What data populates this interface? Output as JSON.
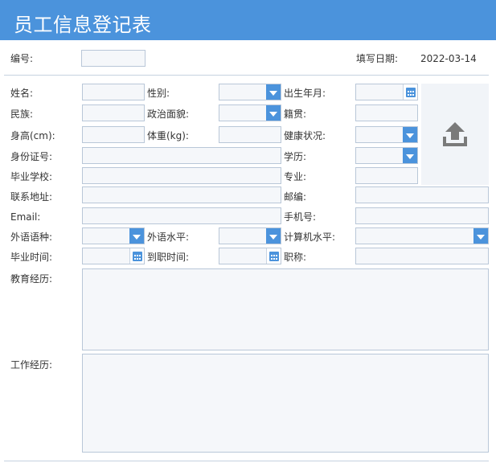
{
  "window": {
    "title": "员工信息登记表"
  },
  "header": {
    "serial_label": "编号:",
    "serial_value": "",
    "fill_date_label": "填写日期:",
    "fill_date_value": "2022-03-14"
  },
  "form": {
    "name_label": "姓名:",
    "gender_label": "性别:",
    "birth_label": "出生年月:",
    "ethnicity_label": "民族:",
    "political_label": "政治面貌:",
    "native_place_label": "籍贯:",
    "height_label": "身高(cm):",
    "weight_label": "体重(kg):",
    "health_label": "健康状况:",
    "id_number_label": "身份证号:",
    "education_label": "学历:",
    "school_label": "毕业学校:",
    "major_label": "专业:",
    "address_label": "联系地址:",
    "postcode_label": "邮编:",
    "email_label": "Email:",
    "mobile_label": "手机号:",
    "language_label": "外语语种:",
    "language_level_label": "外语水平:",
    "computer_level_label": "计算机水平:",
    "graduation_time_label": "毕业时间:",
    "onboard_time_label": "到职时间:",
    "title_label": "职称:",
    "education_history_label": "教育经历:",
    "work_history_label": "工作经历:"
  },
  "photo": {
    "icon": "upload-icon"
  },
  "colors": {
    "accent": "#4b93dc",
    "field_bg": "#f5f7fa",
    "field_border": "#b9c7d8"
  }
}
